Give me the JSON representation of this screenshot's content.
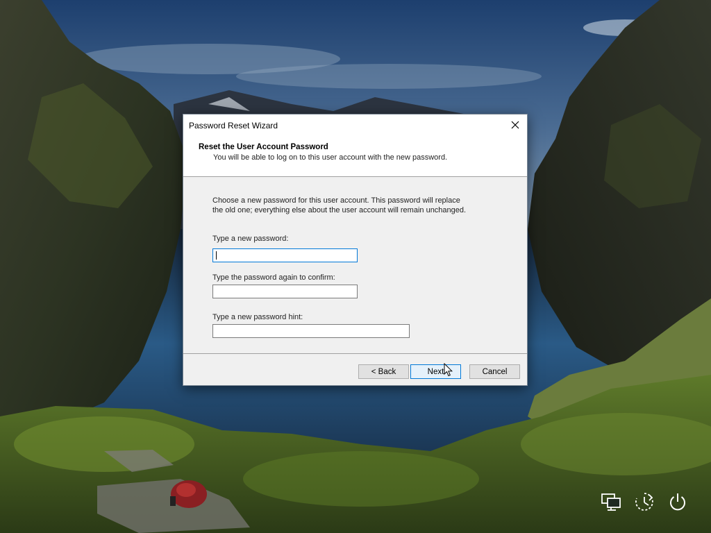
{
  "dialog": {
    "title": "Password Reset Wizard",
    "header_title": "Reset the User Account Password",
    "header_subtitle": "You will be able to log on to this user account with the new password.",
    "description_line1": "Choose a new password for this user account. This password will replace",
    "description_line2": "the old one; everything else about the user account will remain unchanged.",
    "new_password_label": "Type a new password:",
    "new_password_value": "",
    "confirm_password_label": "Type the password again to confirm:",
    "confirm_password_value": "",
    "hint_label": "Type a new password hint:",
    "hint_value": "",
    "back_label": "< Back",
    "next_label": "Next",
    "cancel_label": "Cancel",
    "close_icon": "close-icon"
  },
  "system_icons": {
    "network": "network-icon",
    "ease_of_access": "ease-of-access-icon",
    "power": "power-icon"
  },
  "colors": {
    "focus_accent": "#0078d7",
    "dialog_background": "#f0f0f0"
  }
}
